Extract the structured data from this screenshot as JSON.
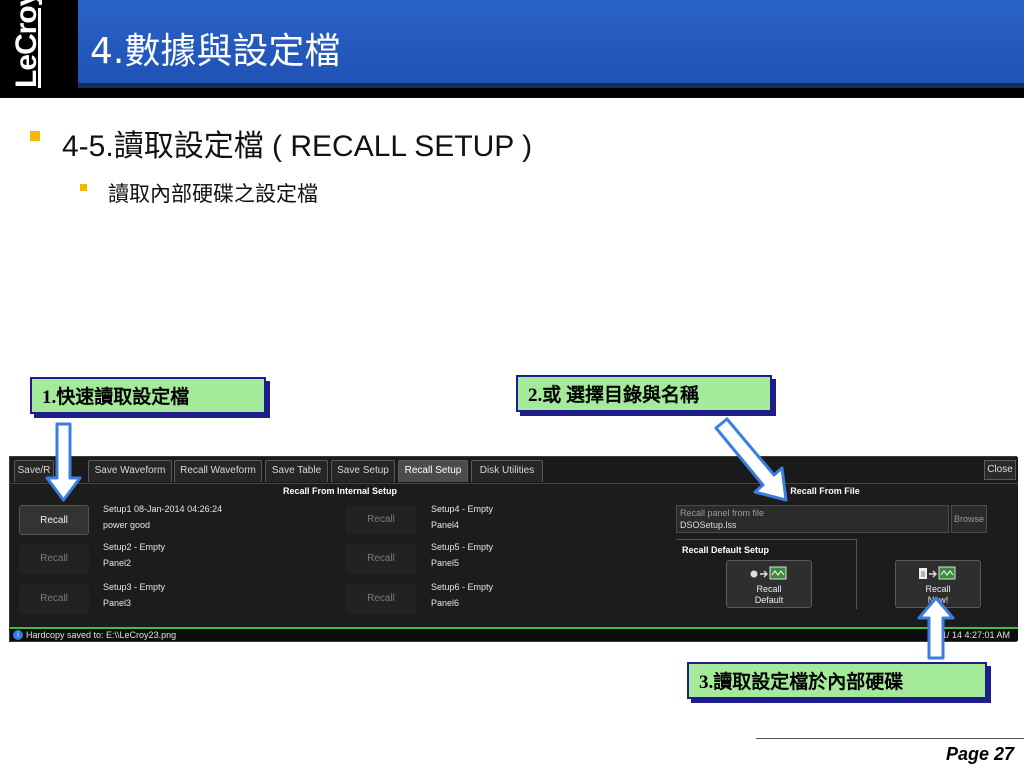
{
  "logo": {
    "text": "LeCroy"
  },
  "title": "4.數據與設定檔",
  "bullets": {
    "level1": "4-5.讀取設定檔 ( RECALL SETUP )",
    "level2": "讀取內部硬碟之設定檔"
  },
  "callouts": {
    "c1": "1.快速讀取設定檔",
    "c2": "2.或 選擇目錄與名稱",
    "c3": "3.讀取設定檔於內部硬碟"
  },
  "scope": {
    "tabs": [
      {
        "label": "Save/R",
        "active": false
      },
      {
        "label": "Save Waveform",
        "active": false
      },
      {
        "label": "Recall Waveform",
        "active": false
      },
      {
        "label": "Save Table",
        "active": false
      },
      {
        "label": "Save Setup",
        "active": false
      },
      {
        "label": "Recall Setup",
        "active": true
      },
      {
        "label": "Disk Utilities",
        "active": false
      }
    ],
    "close_label": "Close",
    "internal_title": "Recall From Internal Setup",
    "file_title": "Recall From File",
    "recall_label": "Recall",
    "setups": [
      {
        "name": "Setup1  08-Jan-2014 04:26:24",
        "panel": "power good",
        "enabled": true
      },
      {
        "name": "Setup2  - Empty",
        "panel": "Panel2",
        "enabled": false
      },
      {
        "name": "Setup3  - Empty",
        "panel": "Panel3",
        "enabled": false
      },
      {
        "name": "Setup4  - Empty",
        "panel": "Panel4",
        "enabled": false
      },
      {
        "name": "Setup5  - Empty",
        "panel": "Panel5",
        "enabled": false
      },
      {
        "name": "Setup6  - Empty",
        "panel": "Panel6",
        "enabled": false
      }
    ],
    "file_placeholder": "Recall panel from file",
    "file_value": "DSOSetup.lss",
    "browse_label": "Browse",
    "default_title": "Recall Default Setup",
    "recall_default": {
      "line1": "Recall",
      "line2": "Default"
    },
    "recall_now": {
      "line1": "Recall",
      "line2": "Now!"
    },
    "status_message": "Hardcopy saved to: E:\\\\LeCroy23.png",
    "status_time": "1/  14 4:27:01 AM"
  },
  "colors": {
    "title_band": "#2c63c8",
    "bullet": "#f5b800",
    "callout_bg": "#a4ea9a",
    "callout_border": "#1d1d8c",
    "arrow_fill": "#ffffff",
    "arrow_stroke": "#3a7fe0",
    "status_accent": "#3fbf3f"
  },
  "footer": {
    "page": "Page 27"
  }
}
